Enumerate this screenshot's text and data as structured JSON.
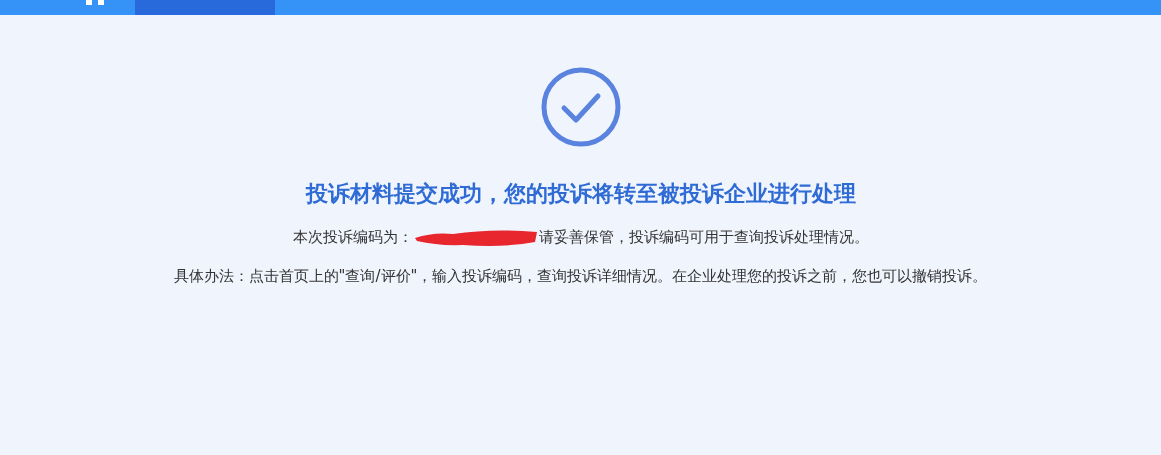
{
  "top_bar": {
    "tabs": [
      {
        "selected": true
      }
    ]
  },
  "result": {
    "title": "投诉材料提交成功，您的投诉将转至被投诉企业进行处理",
    "code_line": {
      "prefix": "本次投诉编码为：",
      "redacted": true,
      "suffix": "请妥善保管，投诉编码可用于查询投诉处理情况。"
    },
    "method_line": "具体办法：点击首页上的\"查询/评价\"，输入投诉编码，查询投诉详细情况。在企业处理您的投诉之前，您也可以撤销投诉。"
  }
}
